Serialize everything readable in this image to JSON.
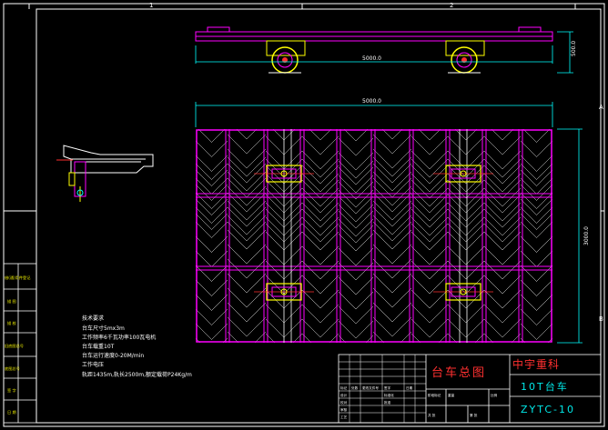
{
  "border": {
    "column_marks": [
      "1",
      "2"
    ],
    "row_marks": [
      "A",
      "B"
    ]
  },
  "dimensions": {
    "side_length": "5000.0",
    "side_height": "500.0",
    "top_length": "5000.0",
    "top_width": "3000.0"
  },
  "notes": {
    "heading": "技术要求",
    "lines": [
      "台车尺寸5mx3m",
      "工作频率6千瓦功率100瓦电机",
      "台车载重10T",
      "台车运行速度0-20M/min",
      "工作电压",
      "轨距1435m,轨长2500m,额定载荷P24Kg/m"
    ]
  },
  "left_strip": {
    "labels": [
      "借(通)用件登记",
      "描 图",
      "描 校",
      "旧底图总号",
      "底图总号",
      "签 字",
      "日 期"
    ]
  },
  "title_block": {
    "company": "中宇重科",
    "drawing_name": "台车总图",
    "product": "10T台车",
    "drawing_number": "ZYTC-10",
    "small_cells": [
      "标记",
      "处数",
      "更改文件号",
      "签字",
      "日期",
      "设计",
      "校对",
      "审核",
      "工艺",
      "标准化",
      "批准",
      "阶段标记",
      "重量",
      "比例",
      "共 张",
      "第 张"
    ]
  },
  "colors": {
    "background": "#000000",
    "frame": "#ffffff",
    "structure": "#ff00ff",
    "hatch": "#ffffff",
    "dimension": "#00ffff",
    "wheel": "#ffff00",
    "center_line": "#ff3030"
  }
}
